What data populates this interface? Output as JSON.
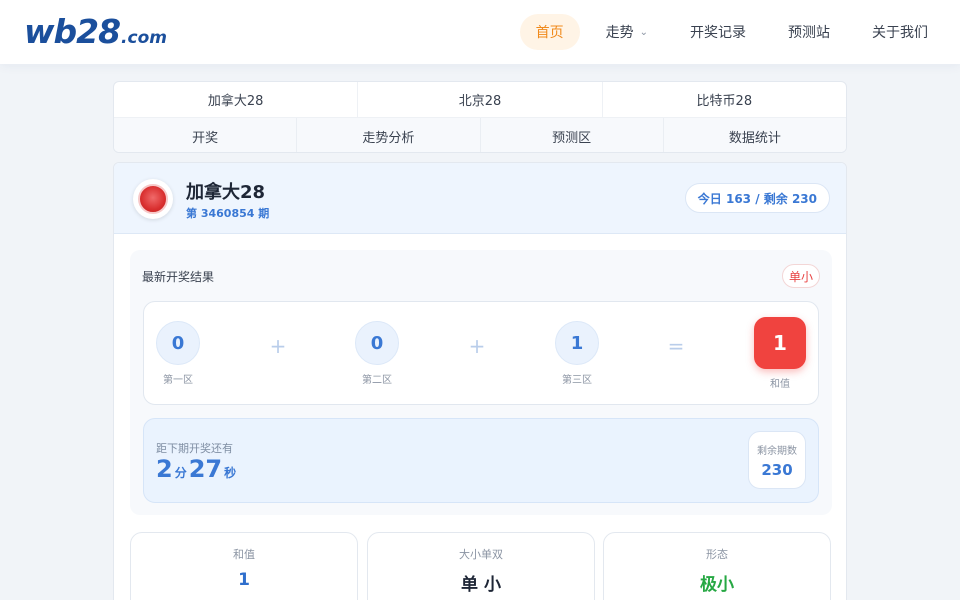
{
  "header": {
    "logo": {
      "main": "wb28",
      "suffix": ".com"
    },
    "nav": [
      {
        "label": "首页",
        "active": true
      },
      {
        "label": "走势",
        "has_dropdown": true
      },
      {
        "label": "开奖记录"
      },
      {
        "label": "预测站"
      },
      {
        "label": "关于我们"
      }
    ]
  },
  "tabs": {
    "games": [
      "加拿大28",
      "北京28",
      "比特币28"
    ],
    "sections": [
      "开奖",
      "走势分析",
      "预测区",
      "数据统计"
    ]
  },
  "lottery": {
    "name": "加拿大28",
    "issue": "第 3460854 期",
    "stats": "今日 163 / 剩余 230"
  },
  "result": {
    "title": "最新开奖结果",
    "badge": "单小",
    "balls": [
      {
        "value": "0",
        "label": "第一区"
      },
      {
        "value": "0",
        "label": "第二区"
      },
      {
        "value": "1",
        "label": "第三区"
      }
    ],
    "plus": "+",
    "equals": "=",
    "sum": {
      "value": "1",
      "label": "和值"
    }
  },
  "countdown": {
    "label": "距下期开奖还有",
    "minutes": "2",
    "minutes_unit": "分",
    "seconds": "27",
    "seconds_unit": "秒",
    "next_label": "剩余期数",
    "next_value": "230"
  },
  "stats": [
    {
      "label": "和值",
      "value": "1",
      "color": "#2f6fcc"
    },
    {
      "label": "大小单双",
      "value": "单 小",
      "color": "#1e2636"
    },
    {
      "label": "形态",
      "value": "极小",
      "color": "#27a844"
    }
  ]
}
